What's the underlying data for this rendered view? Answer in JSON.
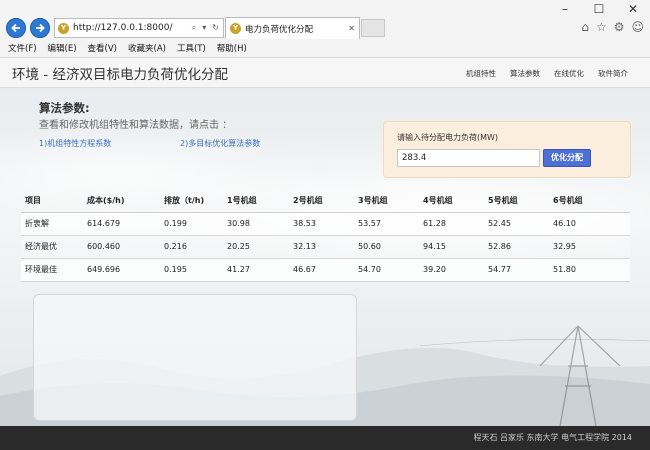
{
  "window": {
    "minimize": "–",
    "maximize": "☐",
    "close": "✕"
  },
  "browser": {
    "url": "http://127.0.0.1:8000/",
    "tab_title": "电力负荷优化分配",
    "menu": [
      "文件(F)",
      "编辑(E)",
      "查看(V)",
      "收藏夹(A)",
      "工具(T)",
      "帮助(H)"
    ]
  },
  "header": {
    "brand": "环境 - 经济双目标电力负荷优化分配",
    "nav": [
      "机组特性",
      "算法参数",
      "在线优化",
      "软件简介"
    ]
  },
  "load_form": {
    "label": "请输入待分配电力负荷(MW)",
    "value": "283.4",
    "button": "优化分配"
  },
  "results": {
    "headers": [
      "项目",
      "成本($/h)",
      "排放（t/h)",
      "1号机组",
      "2号机组",
      "3号机组",
      "4号机组",
      "5号机组",
      "6号机组"
    ],
    "rows": [
      [
        "折衷解",
        "614.679",
        "0.199",
        "30.98",
        "38.53",
        "53.57",
        "61.28",
        "52.45",
        "46.10"
      ],
      [
        "经济最优",
        "600.460",
        "0.216",
        "20.25",
        "32.13",
        "50.60",
        "94.15",
        "52.86",
        "32.95"
      ],
      [
        "环境最佳",
        "649.696",
        "0.195",
        "41.27",
        "46.67",
        "54.70",
        "39.20",
        "54.77",
        "51.80"
      ]
    ]
  },
  "params": {
    "title": "算法参数:",
    "desc": "查看和修改机组特性和算法数据，请点击 ：",
    "link1": "1)机组特性方程系数",
    "link2": "2)多目标优化算法参数"
  },
  "footer": {
    "text": "程天石 吕家乐 东南大学 电气工程学院 2014"
  }
}
